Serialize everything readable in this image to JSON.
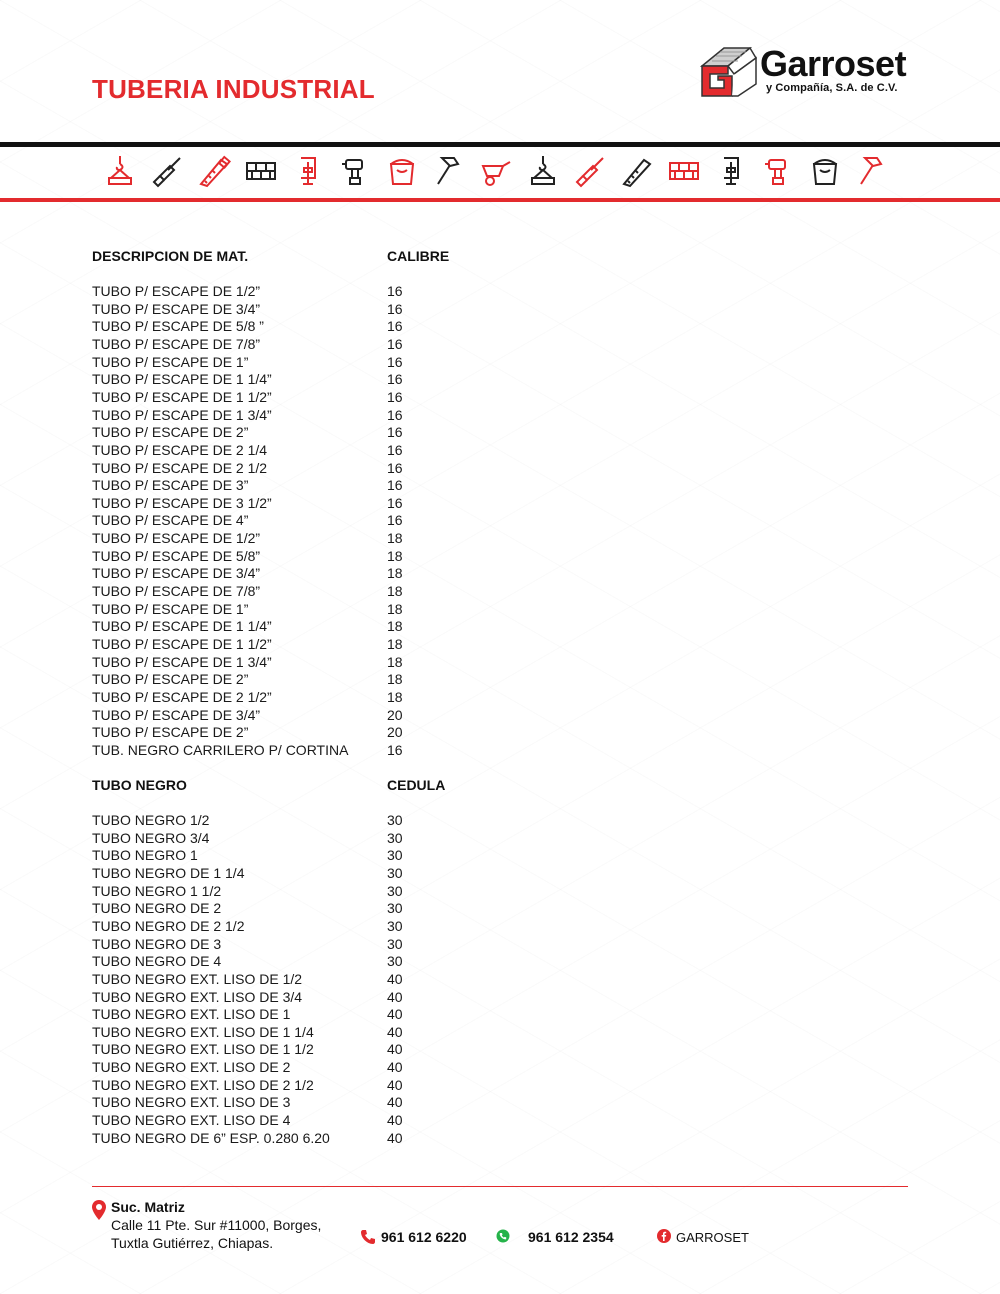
{
  "page_title": "TUBERIA INDUSTRIAL",
  "logo": {
    "name": "Garroset",
    "subtitle": "y Compañía, S.A. de C.V."
  },
  "colors": {
    "accent": "#e32b2e",
    "text": "#1a1a1a",
    "bar": "#111111"
  },
  "tool_icons": [
    "crane-hook-icon",
    "paintbrush-icon",
    "handsaw-icon",
    "bricks-icon",
    "clamp-icon",
    "drill-icon",
    "paint-bucket-icon",
    "hammer-icon",
    "wheelbarrow-icon",
    "crane-hook-icon",
    "paintbrush-icon",
    "handsaw-icon",
    "bricks-icon",
    "clamp-icon",
    "drill-icon",
    "paint-bucket-icon",
    "hammer-icon"
  ],
  "section1": {
    "col_desc": "DESCRIPCION DE MAT.",
    "col_val": "CALIBRE",
    "rows": [
      {
        "desc": "TUBO P/ ESCAPE DE 1/2”",
        "val": "16"
      },
      {
        "desc": "TUBO P/ ESCAPE DE 3/4”",
        "val": "16"
      },
      {
        "desc": "TUBO P/ ESCAPE DE 5/8 ”",
        "val": "16"
      },
      {
        "desc": "TUBO P/ ESCAPE DE 7/8”",
        "val": "16"
      },
      {
        "desc": "TUBO P/ ESCAPE DE 1”",
        "val": "16"
      },
      {
        "desc": "TUBO P/ ESCAPE DE 1 1/4”",
        "val": "16"
      },
      {
        "desc": "TUBO P/ ESCAPE DE 1 1/2”",
        "val": "16"
      },
      {
        "desc": "TUBO P/ ESCAPE DE 1 3/4”",
        "val": "16"
      },
      {
        "desc": "TUBO P/ ESCAPE DE 2”",
        "val": "16"
      },
      {
        "desc": "TUBO P/ ESCAPE DE 2 1/4",
        "val": "16"
      },
      {
        "desc": "TUBO P/ ESCAPE DE 2 1/2",
        "val": "16"
      },
      {
        "desc": "TUBO P/ ESCAPE DE 3”",
        "val": "16"
      },
      {
        "desc": "TUBO P/ ESCAPE DE 3 1/2”",
        "val": "16"
      },
      {
        "desc": "TUBO P/ ESCAPE DE 4”",
        "val": "16"
      },
      {
        "desc": "TUBO P/ ESCAPE DE 1/2”",
        "val": "18"
      },
      {
        "desc": "TUBO P/ ESCAPE DE 5/8”",
        "val": "18"
      },
      {
        "desc": "TUBO P/ ESCAPE DE 3/4”",
        "val": "18"
      },
      {
        "desc": "TUBO P/ ESCAPE DE 7/8”",
        "val": "18"
      },
      {
        "desc": "TUBO P/ ESCAPE DE 1”",
        "val": "18"
      },
      {
        "desc": "TUBO P/ ESCAPE DE 1 1/4”",
        "val": "18"
      },
      {
        "desc": "TUBO P/ ESCAPE DE 1 1/2”",
        "val": "18"
      },
      {
        "desc": "TUBO P/ ESCAPE DE 1 3/4”",
        "val": "18"
      },
      {
        "desc": "TUBO P/ ESCAPE DE 2”",
        "val": "18"
      },
      {
        "desc": "TUBO P/ ESCAPE DE 2 1/2”",
        "val": "18"
      },
      {
        "desc": "TUBO P/ ESCAPE DE 3/4”",
        "val": "20"
      },
      {
        "desc": "TUBO P/ ESCAPE DE 2”",
        "val": "20"
      },
      {
        "desc": "TUB. NEGRO CARRILERO P/ CORTINA",
        "val": "16"
      }
    ]
  },
  "section2": {
    "col_desc": "TUBO NEGRO",
    "col_val": "CEDULA",
    "rows": [
      {
        "desc": "TUBO NEGRO 1/2",
        "val": "30"
      },
      {
        "desc": "TUBO NEGRO 3/4",
        "val": "30"
      },
      {
        "desc": "TUBO NEGRO 1",
        "val": "30"
      },
      {
        "desc": "TUBO NEGRO DE 1 1/4",
        "val": "30"
      },
      {
        "desc": "TUBO NEGRO 1 1/2",
        "val": "30"
      },
      {
        "desc": "TUBO NEGRO DE 2",
        "val": "30"
      },
      {
        "desc": "TUBO NEGRO DE 2 1/2",
        "val": "30"
      },
      {
        "desc": "TUBO NEGRO DE 3",
        "val": "30"
      },
      {
        "desc": "TUBO NEGRO DE 4",
        "val": "30"
      },
      {
        "desc": "TUBO NEGRO EXT. LISO DE 1/2",
        "val": "40"
      },
      {
        "desc": "TUBO NEGRO EXT. LISO DE 3/4",
        "val": "40"
      },
      {
        "desc": "TUBO NEGRO EXT. LISO DE 1",
        "val": "40"
      },
      {
        "desc": "TUBO NEGRO EXT. LISO DE 1 1/4",
        "val": "40"
      },
      {
        "desc": "TUBO NEGRO EXT. LISO DE 1 1/2",
        "val": "40"
      },
      {
        "desc": "TUBO NEGRO EXT. LISO DE 2",
        "val": "40"
      },
      {
        "desc": "TUBO NEGRO EXT. LISO DE 2 1/2",
        "val": "40"
      },
      {
        "desc": "TUBO NEGRO EXT. LISO DE 3",
        "val": "40"
      },
      {
        "desc": "TUBO NEGRO EXT. LISO DE 4",
        "val": "40"
      },
      {
        "desc": "TUBO NEGRO DE 6” ESP. 0.280 6.20",
        "val": "40"
      }
    ]
  },
  "footer": {
    "branch_title": "Suc. Matriz",
    "address_line1": "Calle 11 Pte. Sur #11000, Borges,",
    "address_line2": "Tuxtla Gutiérrez, Chiapas.",
    "phone": "961 612 6220",
    "whatsapp": "961 612 2354",
    "facebook": "GARROSET"
  }
}
